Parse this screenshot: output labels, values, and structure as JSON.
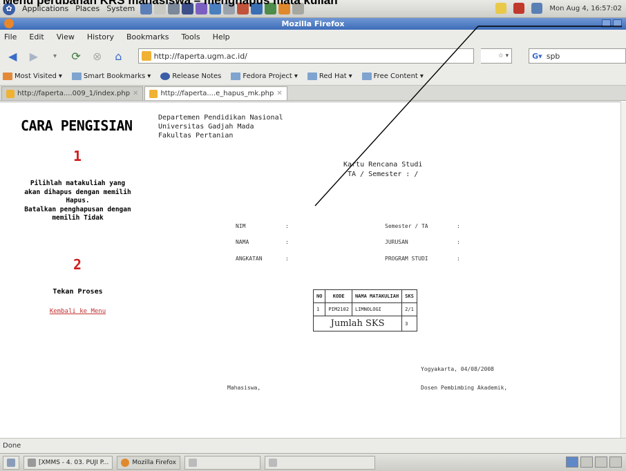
{
  "caption": "Menu perubahan KRS mahasiswa – menghapus mata kuliah",
  "panel": {
    "menus": [
      "Applications",
      "Places",
      "System"
    ],
    "clock": "Mon Aug 4, 16:57:02"
  },
  "window": {
    "title": "Mozilla Firefox"
  },
  "menubar": [
    "File",
    "Edit",
    "View",
    "History",
    "Bookmarks",
    "Tools",
    "Help"
  ],
  "nav": {
    "back_icon": "back-arrow-icon",
    "url": "http://faperta.ugm.ac.id/",
    "search_value": "spb"
  },
  "bookmarks": [
    "Most Visited",
    "Smart Bookmarks",
    "Release Notes",
    "Fedora Project",
    "Red Hat",
    "Free Content"
  ],
  "tabs": [
    {
      "label": "http://faperta....009_1/index.php"
    },
    {
      "label": "http://faperta....e_hapus_mk.php"
    }
  ],
  "left": {
    "heading": "CARA PENGISIAN",
    "step1_num": "1",
    "step1_text": "Pilihlah matakuliah yang\nakan dihapus dengan memilih\nHapus.\nBatalkan penghapusan dengan\nmemilih Tidak",
    "step2_num": "2",
    "step2_text": "Tekan Proses",
    "back_link": "Kembali ke Menu"
  },
  "doc": {
    "dept_line1": "Departemen Pendidikan Nasional",
    "dept_line2": "Universitas Gadjah Mada",
    "dept_line3": "Fakultas Pertanian",
    "title": "Kartu Rencana Studi",
    "subtitle": "TA / Semester :  /",
    "fields_left": [
      {
        "label": "NIM",
        "sep": ":"
      },
      {
        "label": "NAMA",
        "sep": ":"
      },
      {
        "label": "ANGKATAN",
        "sep": ":"
      }
    ],
    "fields_right": [
      {
        "label": "Semester / TA",
        "sep": ":"
      },
      {
        "label": "JURUSAN",
        "sep": ":"
      },
      {
        "label": "PROGRAM STUDI",
        "sep": ":"
      }
    ],
    "table": {
      "headers": [
        "NO",
        "KODE",
        "NAMA MATAKULIAH",
        "SKS"
      ],
      "rows": [
        [
          "1",
          "PIM2102",
          "LIMNOLOGI",
          "2/1"
        ]
      ],
      "total_label": "Jumlah SKS",
      "total_value": "3"
    },
    "date": "Yogyakarta, 04/08/2008",
    "student_sign": "Mahasiswa,",
    "advisor_sign": "Dosen Pembimbing Akademik,"
  },
  "status": "Done",
  "taskbar": [
    "[XMMS - 4. 03. PUJI P...",
    "Mozilla Firefox"
  ]
}
